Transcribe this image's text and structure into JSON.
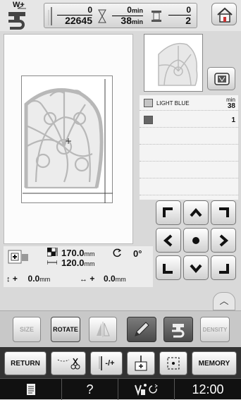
{
  "header": {
    "needle_mode_label": "W+",
    "stitch_counter": {
      "current": "0",
      "total": "22645"
    },
    "time_counter": {
      "current": "0",
      "total": "38",
      "unit": "min"
    },
    "color_counter": {
      "current": "0",
      "total": "2"
    },
    "home_icon": "home-icon"
  },
  "thread_list": {
    "items": [
      {
        "name": "LIGHT BLUE",
        "swatch_color": "#c4c4c4",
        "value": "38",
        "unit": "min"
      },
      {
        "name": "",
        "swatch_color": "#666666",
        "value": "1",
        "unit": ""
      }
    ]
  },
  "info": {
    "width_value": "170.0",
    "height_value": "120.0",
    "size_unit": "mm",
    "rotation_value": "0°",
    "offset_y_value": "0.0",
    "offset_x_value": "0.0",
    "offset_y_prefix": "+",
    "offset_x_prefix": "+",
    "offset_unit": "mm"
  },
  "toolbar": {
    "size_label": "SIZE",
    "rotate_label": "ROTATE",
    "density_label": "DENSITY"
  },
  "bottom": {
    "return_label": "RETURN",
    "memory_label": "MEMORY",
    "needle_label": "-/+"
  },
  "status": {
    "help_label": "?",
    "time": "12:00"
  },
  "colors": {
    "accent": "#cc3333",
    "lace": "#b8b8b8",
    "active_tool": "#ffffff"
  }
}
